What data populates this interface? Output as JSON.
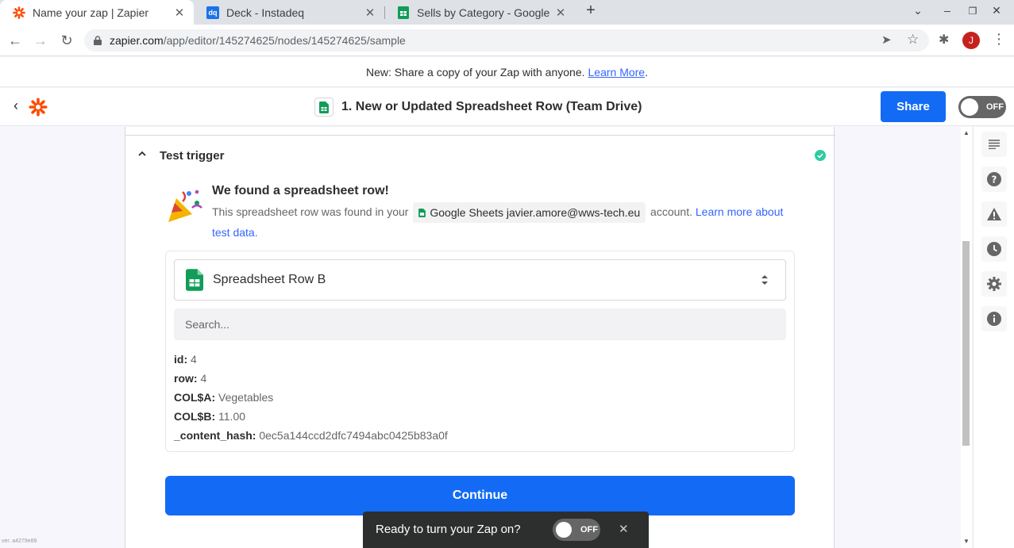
{
  "browser": {
    "tabs": [
      {
        "title": "Name your zap | Zapier",
        "active": true,
        "favicon": "zapier-icon"
      },
      {
        "title": "Deck - Instadeq",
        "active": false,
        "favicon": "instadeq-icon"
      },
      {
        "title": "Sells by Category - Google",
        "active": false,
        "favicon": "google-sheets-icon"
      }
    ],
    "favicon_text": "dq",
    "url_domain": "zapier.com",
    "url_path": "/app/editor/145274625/nodes/145274625/sample",
    "profile_initial": "J"
  },
  "banner": {
    "text": "New: Share a copy of your Zap with anyone.",
    "link": "Learn More",
    "suffix": "."
  },
  "header": {
    "step_title": "1. New or Updated Spreadsheet Row (Team Drive)",
    "share_label": "Share",
    "toggle_label": "OFF"
  },
  "trigger": {
    "section_title": "Test trigger",
    "found_title": "We found a spreadsheet row!",
    "desc_before": "This spreadsheet row was found in your",
    "account_chip": "Google Sheets javier.amore@wws-tech.eu",
    "desc_after": "account.",
    "learn_more": "Learn more about test data.",
    "selector_label": "Spreadsheet Row B",
    "search_placeholder": "Search...",
    "fields": [
      {
        "key": "id:",
        "value": "4"
      },
      {
        "key": "row:",
        "value": "4"
      },
      {
        "key": "COL$A:",
        "value": "Vegetables"
      },
      {
        "key": "COL$B:",
        "value": "11.00"
      },
      {
        "key": "_content_hash:",
        "value": "0ec5a144ccd2dfc7494abc0425b83a0f"
      }
    ],
    "continue_label": "Continue"
  },
  "toast": {
    "text": "Ready to turn your Zap on?",
    "toggle_label": "OFF"
  },
  "version": "ver. a4279e89",
  "colors": {
    "primary": "#136bf5",
    "zapier_orange": "#ff4a00",
    "sheets_green": "#0f9d58",
    "success": "#2fcba1"
  }
}
